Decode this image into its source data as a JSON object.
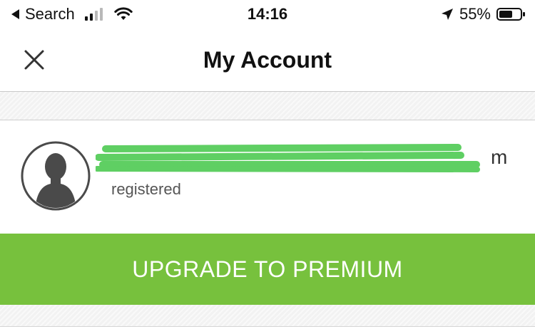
{
  "status_bar": {
    "back_label": "Search",
    "time": "14:16",
    "battery": "55%",
    "icons": [
      "back-arrow-icon",
      "cellular-signal-icon",
      "wifi-icon",
      "location-arrow-icon",
      "battery-icon"
    ]
  },
  "nav": {
    "title": "My Account",
    "close_icon": "close-icon"
  },
  "account": {
    "email_visible": "m",
    "status": "registered",
    "avatar_icon": "user-avatar-icon"
  },
  "upgrade": {
    "label": "UPGRADE TO PREMIUM"
  },
  "colors": {
    "accent_green": "#77c13d",
    "redaction_green": "#5fcf63",
    "text_dark": "#111111",
    "pattern_bg": "#f2f2f2"
  }
}
